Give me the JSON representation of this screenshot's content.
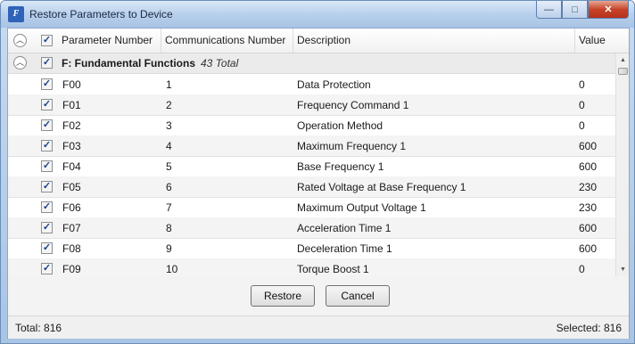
{
  "window": {
    "title": "Restore Parameters to Device",
    "icon_glyph": "F",
    "controls": {
      "minimize": "—",
      "maximize": "□",
      "close": "✕"
    }
  },
  "table": {
    "columns": [
      "Parameter Number",
      "Communications Number",
      "Description",
      "Value"
    ],
    "group": {
      "title": "F: Fundamental Functions",
      "count": "43 Total"
    },
    "rows": [
      {
        "param": "F00",
        "comm": "1",
        "desc": "Data Protection",
        "value": "0"
      },
      {
        "param": "F01",
        "comm": "2",
        "desc": "Frequency Command 1",
        "value": "0"
      },
      {
        "param": "F02",
        "comm": "3",
        "desc": "Operation Method",
        "value": "0"
      },
      {
        "param": "F03",
        "comm": "4",
        "desc": "Maximum Frequency 1",
        "value": "600"
      },
      {
        "param": "F04",
        "comm": "5",
        "desc": "Base Frequency 1",
        "value": "600"
      },
      {
        "param": "F05",
        "comm": "6",
        "desc": "Rated Voltage at Base Frequency 1",
        "value": "230"
      },
      {
        "param": "F06",
        "comm": "7",
        "desc": "Maximum Output Voltage 1",
        "value": "230"
      },
      {
        "param": "F07",
        "comm": "8",
        "desc": "Acceleration Time 1",
        "value": "600"
      },
      {
        "param": "F08",
        "comm": "9",
        "desc": "Deceleration Time 1",
        "value": "600"
      },
      {
        "param": "F09",
        "comm": "10",
        "desc": "Torque Boost 1",
        "value": "0"
      }
    ]
  },
  "icons": {
    "expander": "︿",
    "check": "✓",
    "scroll_up": "▲",
    "scroll_down": "▼"
  },
  "buttons": {
    "restore": "Restore",
    "cancel": "Cancel"
  },
  "status": {
    "total": "Total: 816",
    "selected": "Selected: 816"
  }
}
